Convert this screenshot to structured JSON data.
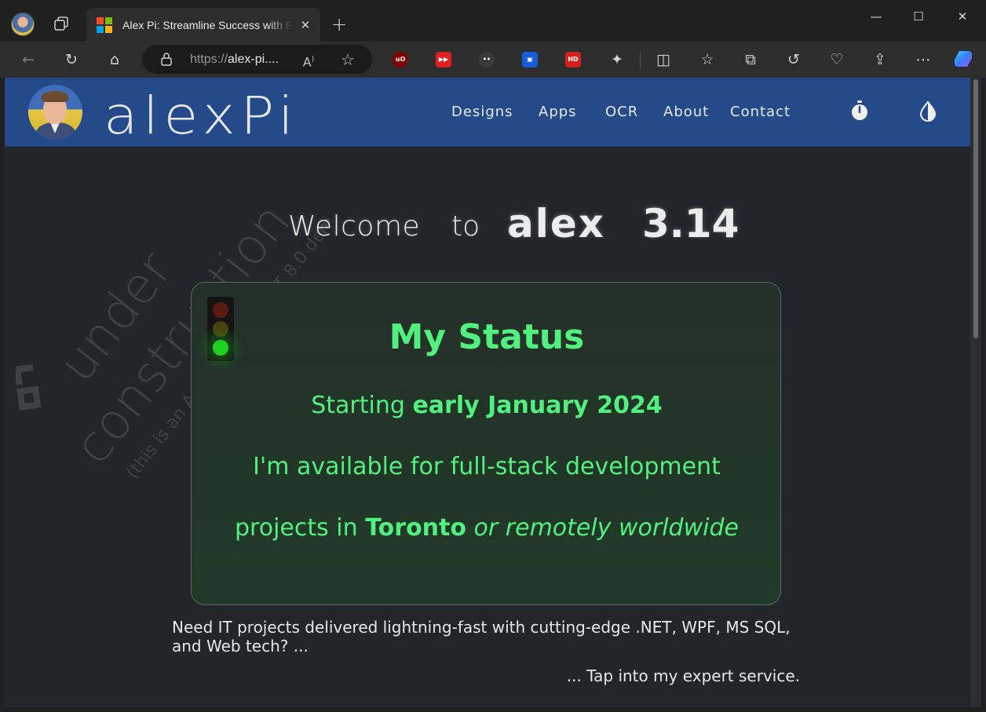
{
  "browser": {
    "tab_title": "Alex Pi: Streamline Success with F",
    "url_protocol": "https://",
    "url_host": "alex-pi....",
    "read_aloud_label": "A",
    "extensions": [
      {
        "name": "ublock",
        "label": "uO",
        "color": "#800000"
      },
      {
        "name": "youtube-ext",
        "label": "▶▶",
        "color": "#e02020"
      },
      {
        "name": "spy-ext",
        "label": "",
        "color": "#3a3a3a"
      },
      {
        "name": "bitwarden",
        "label": "",
        "color": "#175ddc"
      },
      {
        "name": "hd-ext",
        "label": "HD",
        "color": "#d02020"
      }
    ]
  },
  "site": {
    "brand": "alexPi",
    "nav": [
      "Designs",
      "Apps",
      "OCR",
      "About",
      "Contact"
    ],
    "watermark_line1": "under",
    "watermark_line2": "construction",
    "watermark_line3": "(this is an Angular 16 + .NET 8.0 demo)",
    "welcome": {
      "word1": "Welcome",
      "word2": "to",
      "word3": "alex",
      "word4": "3.14"
    },
    "status": {
      "title": "My Status",
      "line1_prefix": "Starting ",
      "line1_bold": "early January 2024",
      "line2": "I'm available for full-stack development",
      "line3_prefix": "projects in ",
      "line3_bold": "Toronto",
      "line3_italic": "or remotely worldwide"
    },
    "intro": "Need IT projects delivered lightning-fast with cutting-edge .NET, WPF, MS SQL, and Web tech? ...",
    "cta": "... Tap into my expert service."
  },
  "colors": {
    "header_bg": "#244a8a",
    "page_bg": "#222529",
    "status_green": "#52f07e"
  }
}
